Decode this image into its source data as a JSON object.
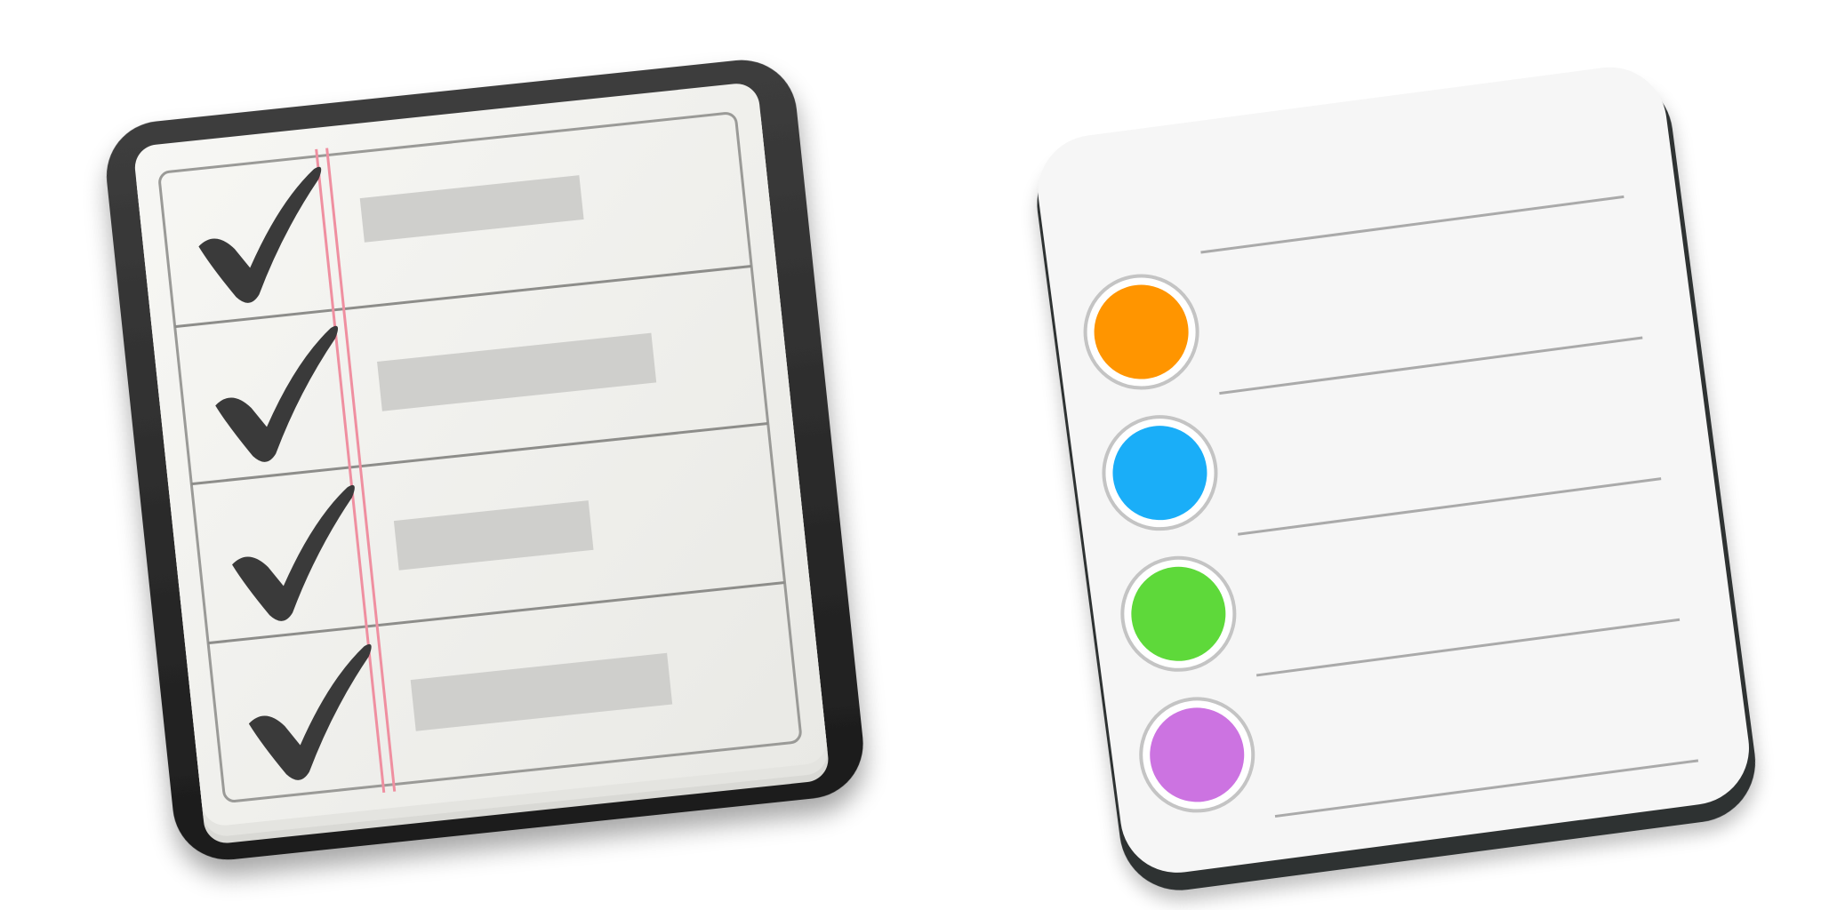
{
  "icons": [
    {
      "id": "old-reminders-icon",
      "style": "skeuomorphic",
      "rows": 4,
      "row_content": [
        "checkmark",
        "checkmark",
        "checkmark",
        "checkmark"
      ],
      "colors": {
        "binder": "#2b2b2b",
        "paper": "#f2f2ef",
        "margin_line": "#ef8fa0",
        "placeholder_bar": "#cfcfcc",
        "checkmark": "#3a3a3a"
      }
    },
    {
      "id": "new-reminders-icon",
      "style": "flat",
      "rows": 4,
      "dot_colors": [
        "#FF9500",
        "#1AAEF8",
        "#5ED93A",
        "#CC73E1"
      ],
      "colors": {
        "base": "#2e3133",
        "paper": "#f6f6f6",
        "rule_line": "#aaaaaa",
        "dot_ring": "#c4c4c4"
      }
    }
  ]
}
